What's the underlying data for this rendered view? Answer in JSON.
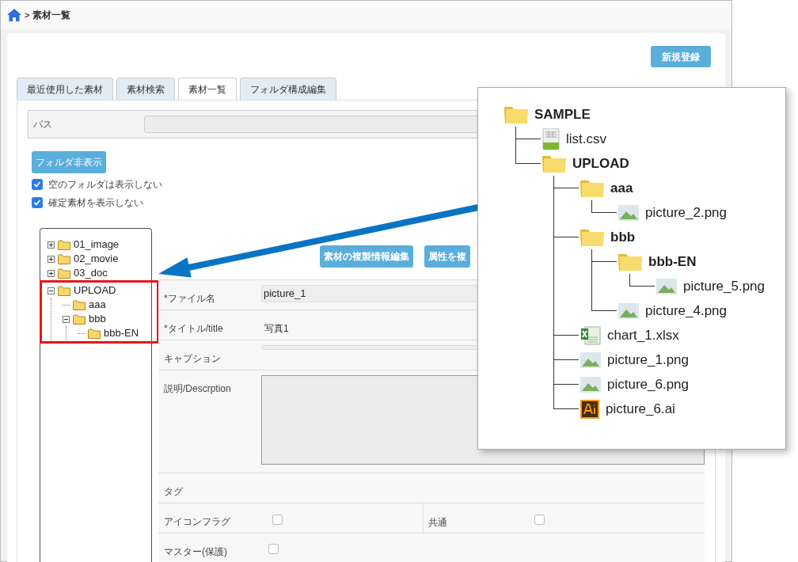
{
  "breadcrumb": {
    "separator": ">",
    "label": "素材一覧"
  },
  "new_button": "新規登録",
  "tabs": [
    {
      "label": "最近使用した素材",
      "selected": false
    },
    {
      "label": "素材検索",
      "selected": false
    },
    {
      "label": "素材一覧",
      "selected": true
    },
    {
      "label": "フォルダ構成編集",
      "selected": false
    }
  ],
  "path": {
    "label": "パス"
  },
  "folder_toggle_button": "フォルダ非表示",
  "options": [
    {
      "label": "空のフォルダは表示しない",
      "checked": true
    },
    {
      "label": "確定素材を表示しない",
      "checked": true
    }
  ],
  "folder_tree": [
    {
      "name": "01_image",
      "expanded": false,
      "highlighted": false
    },
    {
      "name": "02_movie",
      "expanded": false,
      "highlighted": false
    },
    {
      "name": "03_doc",
      "expanded": false,
      "highlighted": false
    },
    {
      "name": "UPLOAD",
      "expanded": true,
      "highlighted": true,
      "children": [
        {
          "name": "aaa"
        },
        {
          "name": "bbb",
          "expanded": true,
          "children": [
            {
              "name": "bbb-EN"
            }
          ]
        }
      ]
    }
  ],
  "action_buttons": [
    "素材の複製情報編集",
    "属性を複"
  ],
  "form_rows": [
    {
      "kind": "input",
      "label": "*ファイル名",
      "value": "picture_1"
    },
    {
      "kind": "text",
      "label": "*タイトル/title",
      "value": "写真1"
    },
    {
      "kind": "input",
      "label": "キャプション"
    },
    {
      "kind": "textarea",
      "label": "説明/Descrption"
    },
    {
      "kind": "text",
      "label": "タグ"
    },
    {
      "kind": "checkbox_pair",
      "label": "アイコンフラグ",
      "checked": false,
      "label_2": "共通",
      "checked_2": false
    },
    {
      "kind": "checkbox",
      "label": "マスター(保護)",
      "checked": false
    }
  ],
  "file_structure": [
    {
      "name": "SAMPLE",
      "kind": "folder",
      "children": [
        {
          "name": "list.csv",
          "kind": "csv"
        },
        {
          "name": "UPLOAD",
          "kind": "folder",
          "children": [
            {
              "name": "aaa",
              "kind": "folder",
              "children": [
                {
                  "name": "picture_2.png",
                  "kind": "image"
                }
              ]
            },
            {
              "name": "bbb",
              "kind": "folder",
              "children": [
                {
                  "name": "bbb-EN",
                  "kind": "folder",
                  "children": [
                    {
                      "name": "picture_5.png",
                      "kind": "image"
                    }
                  ]
                },
                {
                  "name": "picture_4.png",
                  "kind": "image"
                }
              ]
            },
            {
              "name": "chart_1.xlsx",
              "kind": "excel"
            },
            {
              "name": "picture_1.png",
              "kind": "image"
            },
            {
              "name": "picture_6.png",
              "kind": "image"
            },
            {
              "name": "picture_6.ai",
              "kind": "ai"
            }
          ]
        }
      ]
    }
  ]
}
